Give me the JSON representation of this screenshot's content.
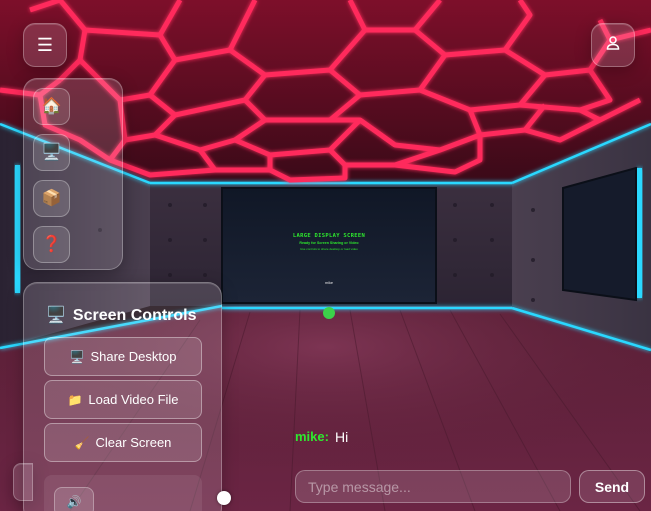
{
  "screen_display": {
    "title": "LARGE DISPLAY SCREEN",
    "subtitle": "Ready for Screen Sharing or Video",
    "caption": "Use controls to share desktop or load video",
    "owner_tag": "mike"
  },
  "toolbar": {
    "menu_icon": "☰",
    "user_icon": "user-icon",
    "items": [
      {
        "icon": "🏠",
        "name": "home-icon"
      },
      {
        "icon": "🖥️",
        "name": "monitor-icon"
      },
      {
        "icon": "📦",
        "name": "box-icon"
      },
      {
        "icon": "❓",
        "name": "help-icon"
      }
    ]
  },
  "screen_controls": {
    "title_icon": "🖥️",
    "title": "Screen Controls",
    "buttons": [
      {
        "icon": "🖥️",
        "label": "Share Desktop"
      },
      {
        "icon": "📁",
        "label": "Load Video File"
      },
      {
        "icon": "🧹",
        "label": "Clear Screen"
      }
    ],
    "volume_icon": "🔊"
  },
  "chat": {
    "messages": [
      {
        "user": "mike:",
        "text": "Hi"
      }
    ],
    "input_placeholder": "Type message...",
    "send_label": "Send"
  },
  "colors": {
    "ceiling_neon": "#ff2a5c",
    "wall_neon": "#29d8ff",
    "screen_text": "#2ee82e",
    "username": "#2ee82e"
  }
}
